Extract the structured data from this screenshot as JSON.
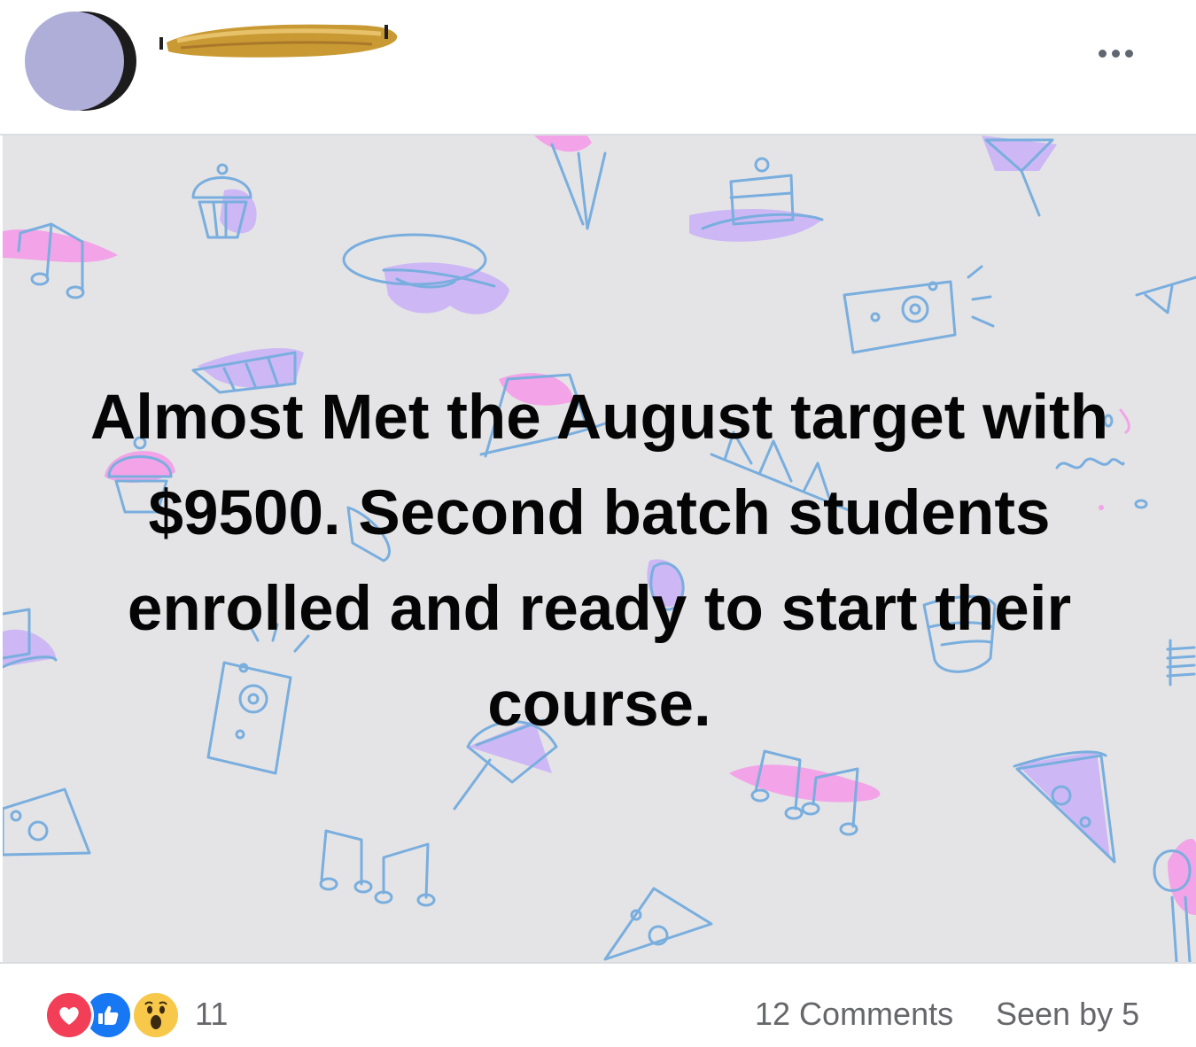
{
  "post": {
    "author_name_redacted": true,
    "text": "Almost Met the August target with $9500. Second batch students enrolled and ready to start their course."
  },
  "header": {
    "more_icon": "ellipsis-icon"
  },
  "footer": {
    "reactions": [
      "love-icon",
      "like-icon",
      "wow-icon"
    ],
    "reaction_count": "11",
    "comments_label": "12 Comments",
    "seen_label": "Seen by 5"
  },
  "colors": {
    "background_gray": "#e4e4e6",
    "doodle_blue": "#79aede",
    "doodle_pink": "#f3a3e7",
    "doodle_lavender": "#cdb8f5",
    "text": "#050505",
    "meta_text": "#65676b"
  }
}
